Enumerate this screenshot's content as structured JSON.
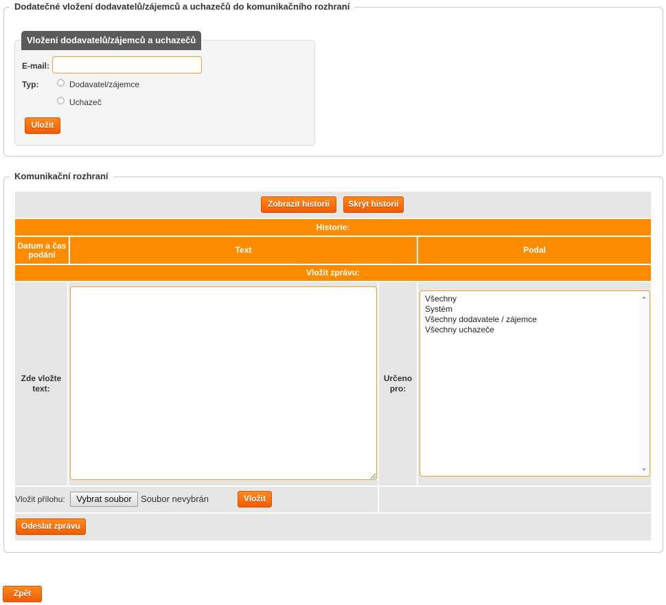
{
  "section1": {
    "legend": "Dodatečné vložení dodavatelů/zájemců a uchazečů do komunikačního rozhraní",
    "panel_title": "Vložení dodavatelů/zájemců a uchazečů",
    "email_label": "E-mail:",
    "email_value": "",
    "type_label": "Typ:",
    "radio_options": [
      "Dodavatel/zájemce",
      "Uchazeč"
    ],
    "save_button": "Uložit"
  },
  "section2": {
    "legend": "Komunikační rozhraní",
    "show_history_button": "Zobrazit historii",
    "hide_history_button": "Skrýt historii",
    "history_header": "Historie:",
    "columns": {
      "datetime": "Datum a čas podání",
      "text": "Text",
      "submitted_by": "Podal"
    },
    "insert_message_header": "Vložit zprávu:",
    "text_label": "Zde vložte text:",
    "recipient_label": "Určeno pro:",
    "recipients": [
      "Všechny",
      "Systém",
      "Všechny dodavatele / zájemce",
      "Všechny uchazeče"
    ],
    "attachment_label": "Vložit přílohu:",
    "choose_file_button": "Vybrat soubor",
    "no_file_text": "Soubor nevybrán",
    "insert_button": "Vložit",
    "send_button": "Odeslat zprávu"
  },
  "back_button": "Zpět",
  "colors": {
    "accent": "#ff8c00",
    "button": "#f35b00",
    "panel_header": "#5b5b5b",
    "grey_cell": "#e6e6e6"
  }
}
